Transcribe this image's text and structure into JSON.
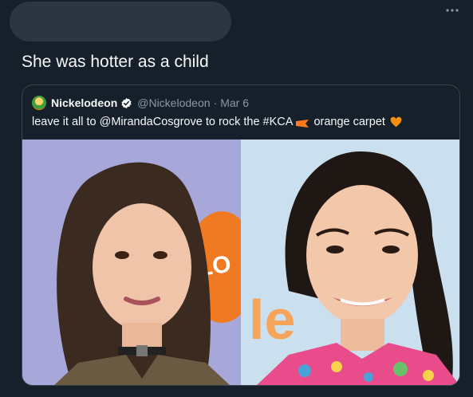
{
  "tweet": {
    "text": "She was hotter as a child",
    "more_icon": "more-icon"
  },
  "quoted": {
    "name": "Nickelodeon",
    "handle": "@Nickelodeon",
    "separator": "·",
    "date": "Mar 6",
    "body_before": "leave it all to @MirandaCosgrove to rock the #KCA",
    "body_after": "orange carpet",
    "icons": [
      "avatar",
      "verified-badge-icon",
      "orange-flag-icon",
      "orange-heart-icon"
    ],
    "images": [
      {
        "desc": "young-child-portrait",
        "bg_text": "LO"
      },
      {
        "desc": "adult-woman-portrait",
        "bg_text": "le"
      }
    ],
    "colors": {
      "orange": "#ff7a1a",
      "verified": "#1d9bf0",
      "heart": "#f4900c"
    }
  }
}
